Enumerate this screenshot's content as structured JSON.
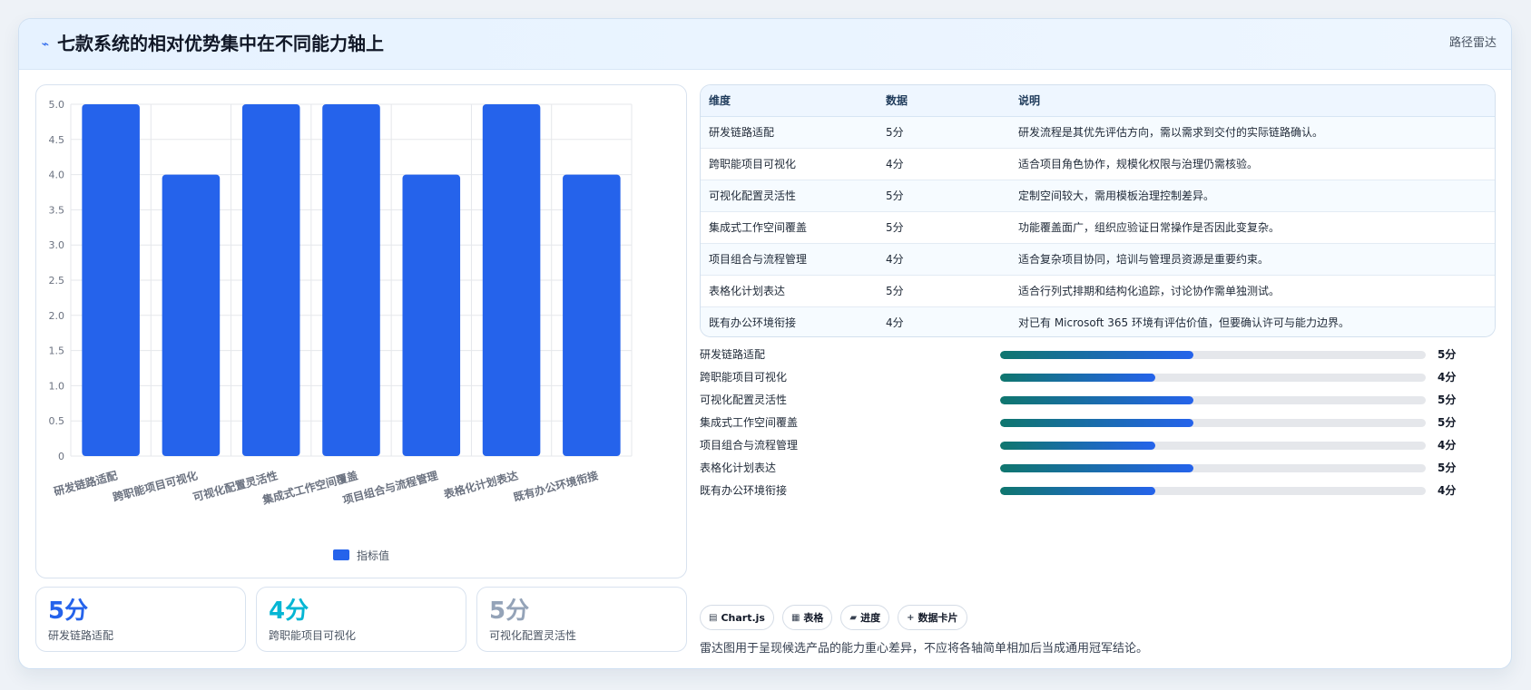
{
  "header": {
    "title_icon": "signal-icon",
    "title": "七款系统的相对优势集中在不同能力轴上",
    "action_label": "路径雷达"
  },
  "chart_data": {
    "type": "bar",
    "categories": [
      "研发链路适配",
      "跨职能项目可视化",
      "可视化配置灵活性",
      "集成式工作空间覆盖",
      "项目组合与流程管理",
      "表格化计划表达",
      "既有办公环境衔接"
    ],
    "series": [
      {
        "name": "指标值",
        "values": [
          5,
          4,
          5,
          5,
          4,
          5,
          4
        ]
      }
    ],
    "ylim": [
      0,
      5
    ],
    "yticks": [
      "0",
      "0.5",
      "1.0",
      "1.5",
      "2.0",
      "2.5",
      "3.0",
      "3.5",
      "4.0",
      "4.5",
      "5.0"
    ],
    "grid": true,
    "legend_position": "bottom",
    "colors": {
      "bar": "#2563eb",
      "grid": "#e5e7eb",
      "axis_text": "#6b7280"
    }
  },
  "stats": [
    {
      "value": "5分",
      "label": "研发链路适配",
      "color": "#2563eb"
    },
    {
      "value": "4分",
      "label": "跨职能项目可视化",
      "color": "#06b6d4"
    },
    {
      "value": "5分",
      "label": "可视化配置灵活性",
      "color": "#94a3b8"
    }
  ],
  "table": {
    "headers": [
      "维度",
      "数据",
      "说明"
    ],
    "rows": [
      [
        "研发链路适配",
        "5分",
        "研发流程是其优先评估方向，需以需求到交付的实际链路确认。"
      ],
      [
        "跨职能项目可视化",
        "4分",
        "适合项目角色协作，规模化权限与治理仍需核验。"
      ],
      [
        "可视化配置灵活性",
        "5分",
        "定制空间较大，需用模板治理控制差异。"
      ],
      [
        "集成式工作空间覆盖",
        "5分",
        "功能覆盖面广，组织应验证日常操作是否因此变复杂。"
      ],
      [
        "项目组合与流程管理",
        "4分",
        "适合复杂项目协同，培训与管理员资源是重要约束。"
      ],
      [
        "表格化计划表达",
        "5分",
        "适合行列式排期和结构化追踪，讨论协作需单独测试。"
      ],
      [
        "既有办公环境衔接",
        "4分",
        "对已有 Microsoft 365 环境有评估价值，但要确认许可与能力边界。"
      ]
    ]
  },
  "progress": {
    "max": 5,
    "items": [
      {
        "label": "研发链路适配",
        "value": 5,
        "score": "5分"
      },
      {
        "label": "跨职能项目可视化",
        "value": 4,
        "score": "4分"
      },
      {
        "label": "可视化配置灵活性",
        "value": 5,
        "score": "5分"
      },
      {
        "label": "集成式工作空间覆盖",
        "value": 5,
        "score": "5分"
      },
      {
        "label": "项目组合与流程管理",
        "value": 4,
        "score": "4分"
      },
      {
        "label": "表格化计划表达",
        "value": 5,
        "score": "5分"
      },
      {
        "label": "既有办公环境衔接",
        "value": 4,
        "score": "4分"
      }
    ]
  },
  "tags": [
    {
      "icon": "chart-icon",
      "glyph": "▤",
      "label": "Chart.js"
    },
    {
      "icon": "table-icon",
      "glyph": "▦",
      "label": "表格"
    },
    {
      "icon": "progress-icon",
      "glyph": "▰",
      "label": "进度"
    },
    {
      "icon": "card-icon",
      "glyph": "+",
      "label": "数据卡片"
    }
  ],
  "footnote": "雷达图用于呈现候选产品的能力重心差异，不应将各轴简单相加后当成通用冠军结论。"
}
